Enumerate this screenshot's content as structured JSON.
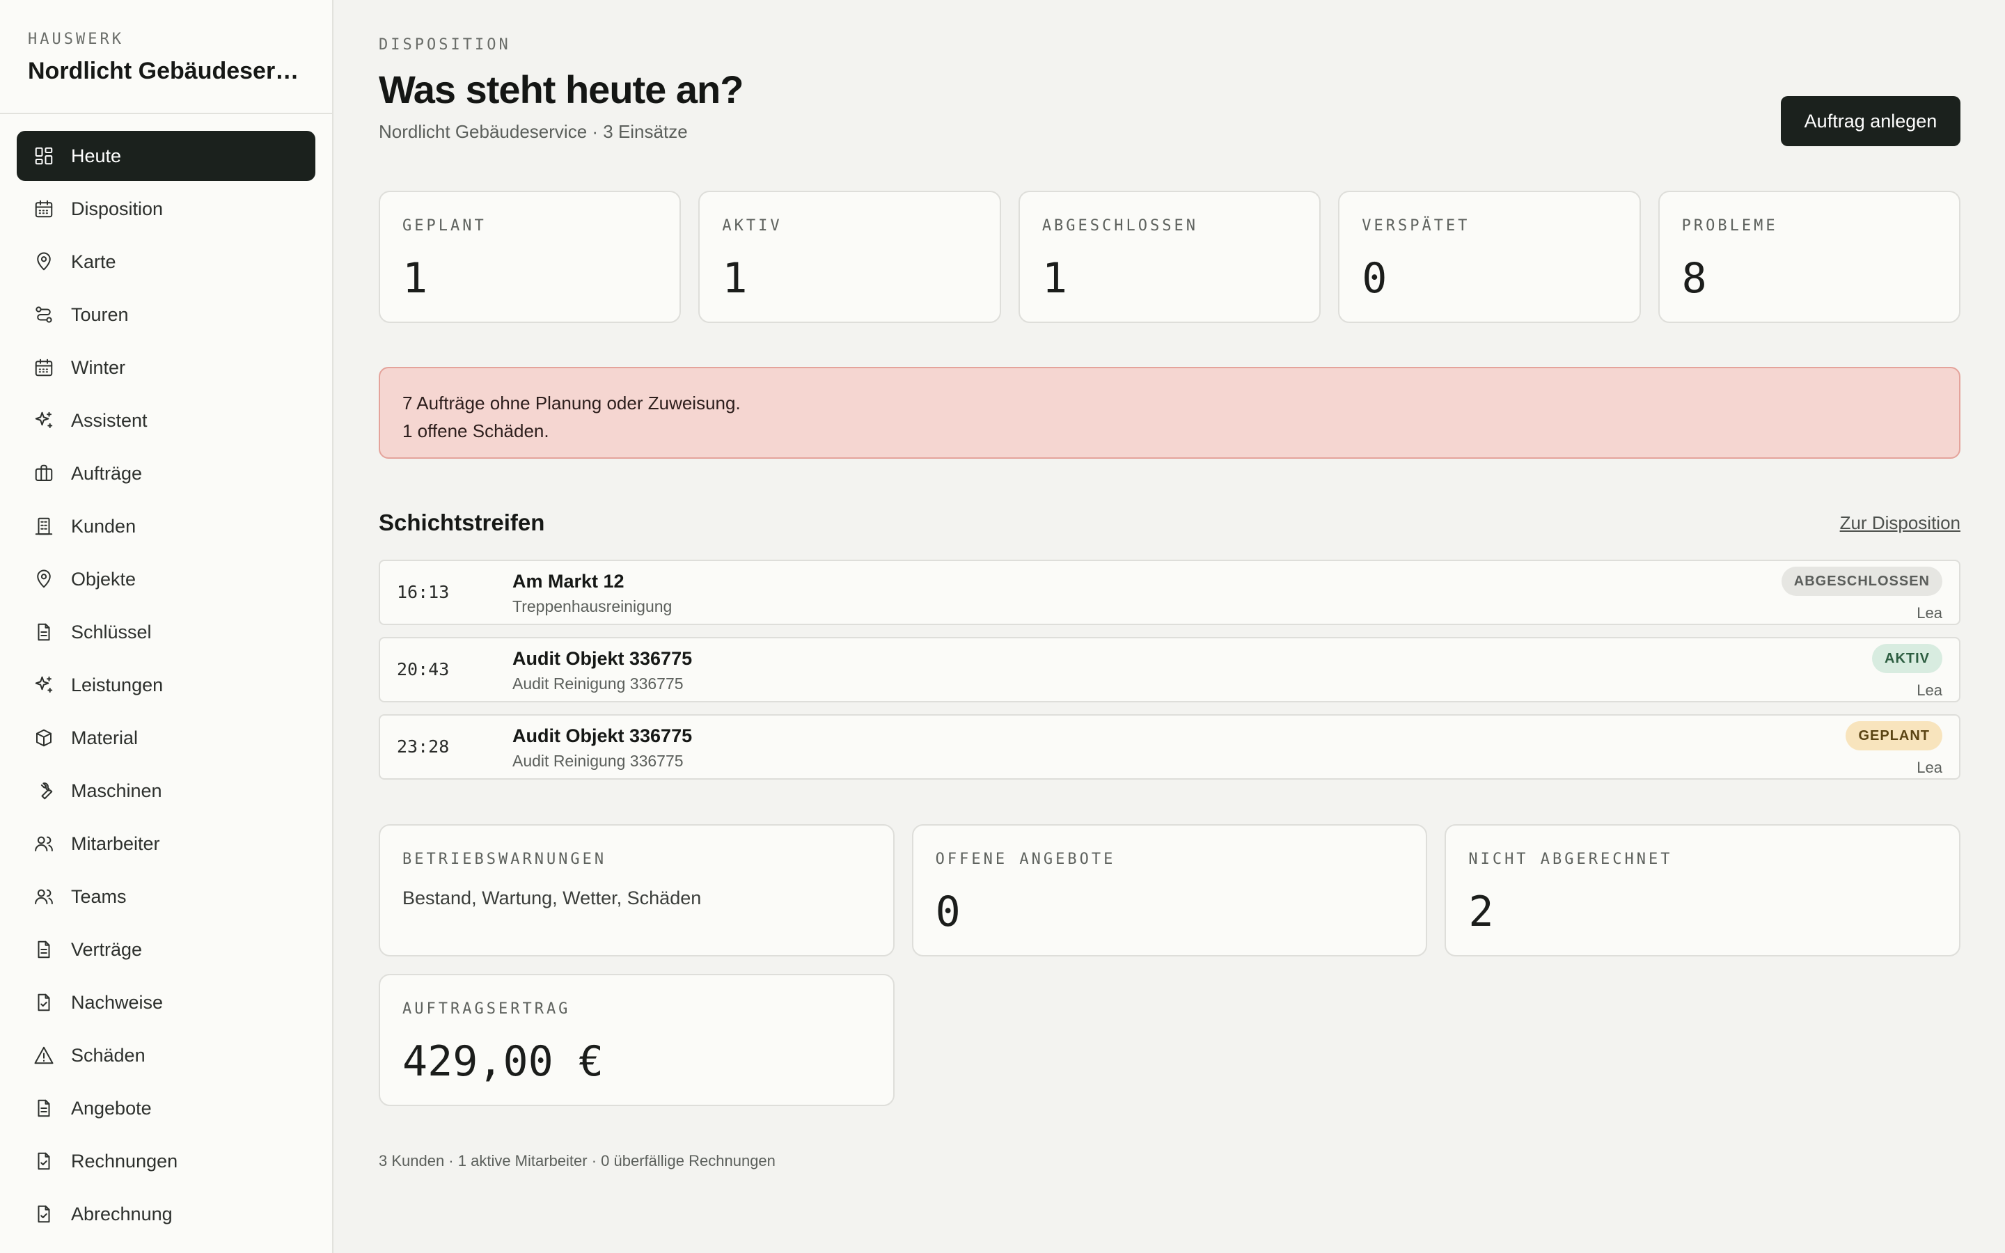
{
  "sidebar": {
    "eyebrow": "HAUSWERK",
    "company": "Nordlicht Gebäudeservi…",
    "items": [
      {
        "label": "Heute",
        "icon": "dashboard-icon",
        "active": true
      },
      {
        "label": "Disposition",
        "icon": "calendar-icon"
      },
      {
        "label": "Karte",
        "icon": "map-pin-icon"
      },
      {
        "label": "Touren",
        "icon": "route-icon"
      },
      {
        "label": "Winter",
        "icon": "calendar-icon"
      },
      {
        "label": "Assistent",
        "icon": "sparkles-icon"
      },
      {
        "label": "Aufträge",
        "icon": "briefcase-icon"
      },
      {
        "label": "Kunden",
        "icon": "building-icon"
      },
      {
        "label": "Objekte",
        "icon": "map-pin-icon"
      },
      {
        "label": "Schlüssel",
        "icon": "document-icon"
      },
      {
        "label": "Leistungen",
        "icon": "sparkles-icon"
      },
      {
        "label": "Material",
        "icon": "package-icon"
      },
      {
        "label": "Maschinen",
        "icon": "wrench-icon"
      },
      {
        "label": "Mitarbeiter",
        "icon": "users-icon"
      },
      {
        "label": "Teams",
        "icon": "users-icon"
      },
      {
        "label": "Verträge",
        "icon": "document-icon"
      },
      {
        "label": "Nachweise",
        "icon": "document-check-icon"
      },
      {
        "label": "Schäden",
        "icon": "warning-icon"
      },
      {
        "label": "Angebote",
        "icon": "document-icon"
      },
      {
        "label": "Rechnungen",
        "icon": "document-check-icon"
      },
      {
        "label": "Abrechnung",
        "icon": "document-check-icon"
      }
    ]
  },
  "header": {
    "eyebrow": "DISPOSITION",
    "title": "Was steht heute an?",
    "subtitle": "Nordlicht Gebäudeservice · 3 Einsätze",
    "primary_action": "Auftrag anlegen"
  },
  "kpis": [
    {
      "label": "GEPLANT",
      "value": "1"
    },
    {
      "label": "AKTIV",
      "value": "1"
    },
    {
      "label": "ABGESCHLOSSEN",
      "value": "1"
    },
    {
      "label": "VERSPÄTET",
      "value": "0"
    },
    {
      "label": "PROBLEME",
      "value": "8"
    }
  ],
  "alert": {
    "line1": "7 Aufträge ohne Planung oder Zuweisung.",
    "line2": "1 offene Schäden."
  },
  "shifts": {
    "title": "Schichtstreifen",
    "link": "Zur Disposition",
    "rows": [
      {
        "time": "16:13",
        "title": "Am Markt 12",
        "subtitle": "Treppenhausreinigung",
        "status": "ABGESCHLOSSEN",
        "assignee": "Lea"
      },
      {
        "time": "20:43",
        "title": "Audit Objekt 336775",
        "subtitle": "Audit Reinigung 336775",
        "status": "AKTIV",
        "assignee": "Lea"
      },
      {
        "time": "23:28",
        "title": "Audit Objekt 336775",
        "subtitle": "Audit Reinigung 336775",
        "status": "GEPLANT",
        "assignee": "Lea"
      }
    ]
  },
  "cards": {
    "warnings": {
      "label": "BETRIEBSWARNUNGEN",
      "text": "Bestand, Wartung, Wetter, Schäden"
    },
    "offers": {
      "label": "OFFENE ANGEBOTE",
      "value": "0"
    },
    "unbilled": {
      "label": "NICHT ABGERECHNET",
      "value": "2"
    },
    "revenue": {
      "label": "AUFTRAGSERTRAG",
      "value": "429,00 €"
    }
  },
  "footer": {
    "summary": "3 Kunden · 1 aktive Mitarbeiter · 0 überfällige Rechnungen"
  },
  "colors": {
    "accent": "#1b211d",
    "alert_bg": "#f5d6d1",
    "alert_border": "#e4a39b",
    "badge_active": "#d8ece0",
    "badge_planned": "#f8e4bd",
    "badge_done": "#e6e6e2"
  }
}
